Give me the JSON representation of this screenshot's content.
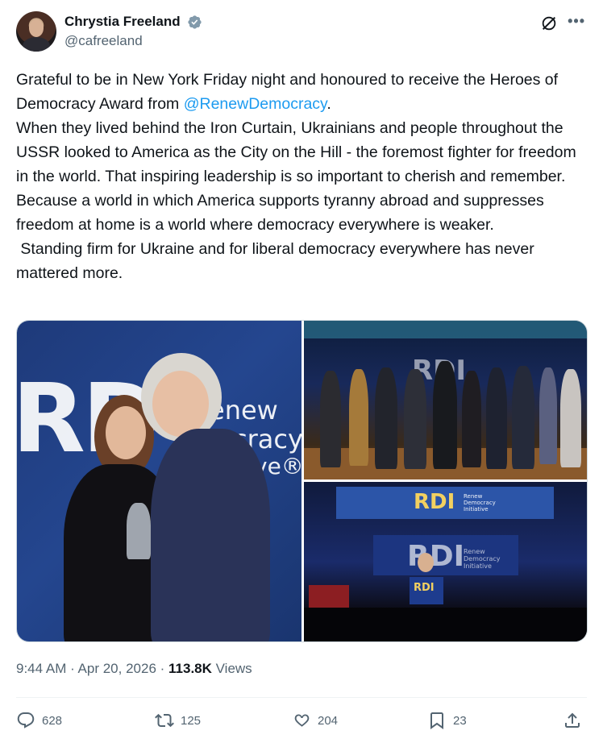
{
  "author": {
    "display_name": "Chrystia Freeland",
    "handle": "@cafreeland",
    "verified": true,
    "avatar_icon": "profile-photo"
  },
  "header_actions": {
    "grok_icon": "grok-icon",
    "more_icon": "more-icon"
  },
  "tweet": {
    "line1": "Grateful to be in New York Friday night and honoured to receive the Heroes of Democracy Award from ",
    "mention": "@RenewDemocracy",
    "line1_end": ".",
    "body": "When they lived behind the Iron Curtain, Ukrainians and people throughout the USSR looked to America as the City on the Hill - the foremost fighter for freedom in the world. That inspiring leadership is so important to cherish and remember. Because a world in which America supports tyranny abroad and suppresses freedom at home is a world where democracy everywhere is weaker.\n Standing firm for Ukraine and for liberal democracy everywhere has never mattered more."
  },
  "media": {
    "photo1": {
      "logo_text": "RD",
      "sub1": "enew",
      "sub2": "cracy",
      "sub3": "ve®"
    },
    "photo2": {
      "banner_text": "RDI"
    },
    "photo3": {
      "banner_text": "RDI",
      "banner_sub": "Renew Democracy Initiative",
      "stage_text": "RDI",
      "stage_sub": "Renew Democracy Initiative",
      "podium_text": "RDI"
    }
  },
  "meta": {
    "time": "9:44 AM",
    "separator": " · ",
    "date": "Apr 20, 2026",
    "views_count": "113.8K",
    "views_label": " Views"
  },
  "actions": {
    "replies": "628",
    "reposts": "125",
    "likes": "204",
    "bookmarks": "23"
  },
  "colors": {
    "link": "#1d9bf0",
    "muted": "#536471",
    "text": "#0f1419",
    "verified": "#829aab"
  }
}
